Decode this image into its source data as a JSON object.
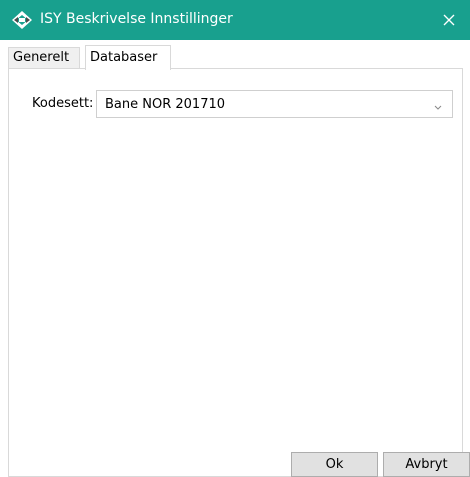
{
  "window": {
    "title": "ISY Beskrivelse Innstillinger",
    "app_icon": "isy-app-icon",
    "close_icon": "close-icon",
    "titlebar_color": "#18a08e"
  },
  "tabs": [
    {
      "label": "Generelt",
      "selected": false
    },
    {
      "label": "Databaser",
      "selected": true
    }
  ],
  "databaser": {
    "kodesett_label": "Kodesett:",
    "kodesett_value": "Bane NOR 201710",
    "dropdown_icon": "chevron-down-icon"
  },
  "buttons": {
    "ok": "Ok",
    "cancel": "Avbryt"
  }
}
